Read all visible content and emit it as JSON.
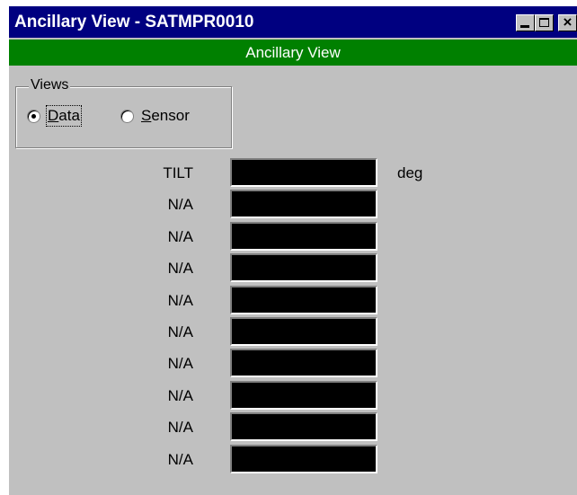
{
  "window": {
    "title": "Ancillary View - SATMPR0010",
    "buttons": {
      "minimize": "_",
      "maximize": "□",
      "close": "×"
    }
  },
  "banner": {
    "text": "Ancillary View"
  },
  "views": {
    "legend": "Views",
    "options": [
      {
        "label": "Data",
        "selected": true
      },
      {
        "label": "Sensor",
        "selected": false
      }
    ]
  },
  "readouts": [
    {
      "label": "TILT",
      "value": "",
      "unit": "deg"
    },
    {
      "label": "N/A",
      "value": "",
      "unit": ""
    },
    {
      "label": "N/A",
      "value": "",
      "unit": ""
    },
    {
      "label": "N/A",
      "value": "",
      "unit": ""
    },
    {
      "label": "N/A",
      "value": "",
      "unit": ""
    },
    {
      "label": "N/A",
      "value": "",
      "unit": ""
    },
    {
      "label": "N/A",
      "value": "",
      "unit": ""
    },
    {
      "label": "N/A",
      "value": "",
      "unit": ""
    },
    {
      "label": "N/A",
      "value": "",
      "unit": ""
    },
    {
      "label": "N/A",
      "value": "",
      "unit": ""
    }
  ],
  "colors": {
    "title_bar": "#000080",
    "banner": "#008000",
    "panel": "#c0c0c0",
    "field": "#000000"
  }
}
